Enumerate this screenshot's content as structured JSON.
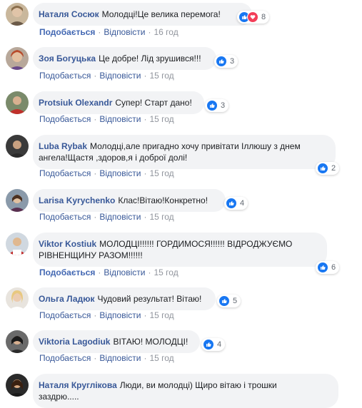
{
  "colors": {
    "author": "#385898",
    "like": "#1877f2",
    "love": "#f33e58",
    "bubble": "#f2f3f5",
    "muted": "#90949c"
  },
  "comments": [
    {
      "author": "Наталя Сосюк",
      "text": "Молодці!Це велика перемога!",
      "reaction_count": "8",
      "like_label": "Подобається",
      "like_active": true,
      "reply_label": "Відповісти",
      "time": "16 год",
      "reactions": [
        "like-icon",
        "love-icon"
      ]
    },
    {
      "author": "Зоя Богуцька",
      "text": "Це добре! Лід зрушився!!!",
      "reaction_count": "3",
      "like_label": "Подобається",
      "reply_label": "Відповісти",
      "time": "15 год",
      "reactions": [
        "like-icon"
      ]
    },
    {
      "author": "Protsiuk Olexandr",
      "text": "Супер! Старт дано!",
      "reaction_count": "3",
      "like_label": "Подобається",
      "reply_label": "Відповісти",
      "time": "15 год",
      "reactions": [
        "like-icon"
      ]
    },
    {
      "author": "Luba Rybak",
      "text_line1": "Молодці,але пригадно хочу привітати Іллюшу з днем",
      "text_line2": "ангела!Щастя ,здоров,я і доброї долі!",
      "reaction_count": "2",
      "like_label": "Подобається",
      "reply_label": "Відповісти",
      "time": "15 год",
      "reactions": [
        "like-icon"
      ]
    },
    {
      "author": "Larisa Kyrychenko",
      "text": "Клас!Вітаю!Конкретно!",
      "reaction_count": "4",
      "like_label": "Подобається",
      "reply_label": "Відповісти",
      "time": "15 год",
      "reactions": [
        "like-icon"
      ]
    },
    {
      "author": "Viktor Kostiuk",
      "text_line1": "МОЛОДЦІ!!!!!! ГОРДИМОСЯ!!!!!! ВІДРОДЖУЄМО",
      "text_line2": "РІВНЕНЩИНУ РАЗОМ!!!!!!",
      "reaction_count": "6",
      "like_label": "Подобається",
      "like_active": true,
      "reply_label": "Відповісти",
      "time": "15 год",
      "reactions": [
        "like-icon"
      ]
    },
    {
      "author": "Ольга Ладюк",
      "text": "Чудовий результат! Вітаю!",
      "reaction_count": "5",
      "like_label": "Подобається",
      "reply_label": "Відповісти",
      "time": "15 год",
      "reactions": [
        "like-icon"
      ]
    },
    {
      "author": "Viktoria Lagodiuk",
      "text": "ВІТАЮ! МОЛОДЦІ!",
      "reaction_count": "4",
      "like_label": "Подобається",
      "reply_label": "Відповісти",
      "time": "15 год",
      "reactions": [
        "like-icon"
      ]
    },
    {
      "author": "Наталя Круглікова",
      "text_line1": "Люди, ви молодці) Щиро вітаю і трошки",
      "text_line2": "заздрю.....",
      "reaction_count": "",
      "like_label": "",
      "reply_label": "",
      "time": "",
      "reactions": []
    }
  ]
}
